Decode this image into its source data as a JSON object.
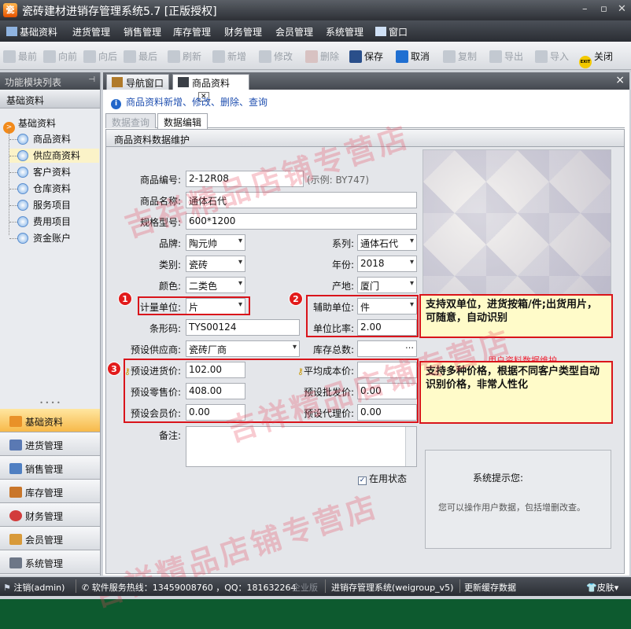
{
  "window": {
    "title": "瓷砖建材进销存管理系统5.7 [正版授权]"
  },
  "menu": [
    "基础资料",
    "进货管理",
    "销售管理",
    "库存管理",
    "财务管理",
    "会员管理",
    "系统管理",
    "窗口"
  ],
  "toolbar": {
    "first": "最前",
    "prev": "向前",
    "next": "向后",
    "last": "最后",
    "refresh": "刷新",
    "add": "新增",
    "edit": "修改",
    "delete": "删除",
    "save": "保存",
    "cancel": "取消",
    "copy": "复制",
    "export": "导出",
    "import": "导入",
    "close": "关闭",
    "exit_badge": "EXIT"
  },
  "left": {
    "panel_title": "功能模块列表",
    "group": "基础资料",
    "root": "基础资料",
    "items": [
      "商品资料",
      "供应商资料",
      "客户资料",
      "仓库资料",
      "服务项目",
      "费用项目",
      "资金账户"
    ],
    "nav": [
      "基础资料",
      "进货管理",
      "销售管理",
      "库存管理",
      "财务管理",
      "会员管理",
      "系统管理"
    ]
  },
  "tabs": {
    "nav": "导航窗口",
    "product": "商品资料"
  },
  "hint": "商品资料新增、修改、删除、查询",
  "subtabs": {
    "query": "数据查询",
    "edit": "数据编辑"
  },
  "form": {
    "header": "商品资料数据维护",
    "code_label": "商品编号:",
    "code": "2-12R08",
    "code_example": "(示例: BY747)",
    "name_label": "商品名称:",
    "name": "通体石代",
    "spec_label": "规格型号:",
    "spec": "600*1200",
    "brand_label": "品牌:",
    "brand": "陶元帅",
    "series_label": "系列:",
    "series": "通体石代",
    "category_label": "类别:",
    "category": "瓷砖",
    "year_label": "年份:",
    "year": "2018",
    "color_label": "颜色:",
    "color": "二类色",
    "origin_label": "产地:",
    "origin": "厦门",
    "unit_label": "计量单位:",
    "unit": "片",
    "aux_unit_label": "辅助单位:",
    "aux_unit": "件",
    "barcode_label": "条形码:",
    "barcode": "TYS00124",
    "ratio_label": "单位比率:",
    "ratio": "2.00",
    "supplier_label": "预设供应商:",
    "supplier": "瓷砖厂商",
    "stock_label": "库存总数:",
    "stock": "",
    "purchase_label": "预设进货价:",
    "purchase": "102.00",
    "avgcost_label": "平均成本价:",
    "avgcost": "",
    "retail_label": "预设零售价:",
    "retail": "408.00",
    "wholesale_label": "预设批发价:",
    "wholesale": "0.00",
    "member_label": "预设会员价:",
    "member": "0.00",
    "agent_label": "预设代理价:",
    "agent": "0.00",
    "memo_label": "备注:",
    "active_label": "在用状态",
    "photo_caption": "用户资料数据维护",
    "sys_title": "系统提示您:",
    "sys_msg": "您可以操作用户数据，包括增删改查。"
  },
  "annotations": {
    "b1": "1",
    "b2": "2",
    "b3": "3",
    "callout1": "支持双单位，进货按箱/件;出货用片，可随意，自动识别",
    "callout2": "支持多种价格，根据不同客户类型自动识别价格，非常人性化"
  },
  "status": {
    "logout": "注销(admin)",
    "hotline": "软件服务热线：13459008760 ，QQ：181632264",
    "edition": "企业版",
    "product": "进销存管理系统(weigroup_v5)",
    "cache": "更新缓存数据",
    "skin": "皮肤"
  },
  "watermark": "吉祥精品店铺专营店",
  "colors": {
    "accent": "#f28a1a",
    "annotation_red": "#d9141b",
    "link_blue": "#1f4fb0"
  }
}
